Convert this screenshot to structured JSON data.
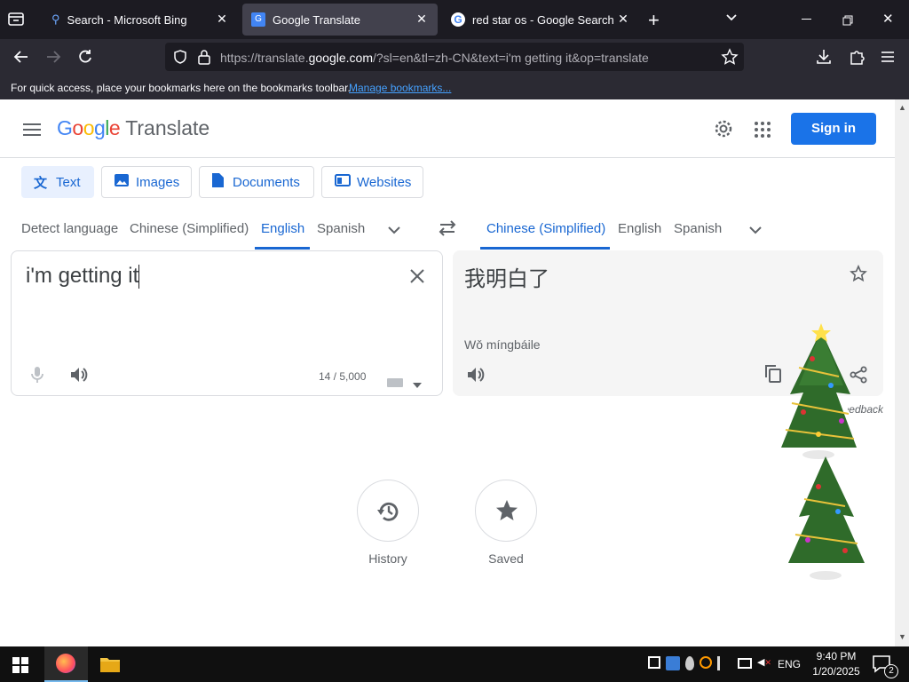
{
  "browser": {
    "tabs": [
      {
        "title": "Search - Microsoft Bing",
        "icon": "search-icon"
      },
      {
        "title": "Google Translate",
        "icon": "translate-icon"
      },
      {
        "title": "red star os - Google Search",
        "icon": "google-icon"
      }
    ],
    "url": {
      "prefix": "https://translate.",
      "domain": "google.com",
      "suffix": "/?sl=en&tl=zh-CN&text=i'm getting it&op=translate"
    },
    "bookmarks_text": "For quick access, place your bookmarks here on the bookmarks toolbar.",
    "bookmarks_link": "Manage bookmarks..."
  },
  "header": {
    "logo": "Google",
    "product": "Translate",
    "signin": "Sign in"
  },
  "modes": [
    "Text",
    "Images",
    "Documents",
    "Websites"
  ],
  "source_langs": [
    "Detect language",
    "Chinese (Simplified)",
    "English",
    "Spanish"
  ],
  "target_langs": [
    "Chinese (Simplified)",
    "English",
    "Spanish"
  ],
  "source": {
    "text": "i'm getting it",
    "count": "14 / 5,000"
  },
  "target": {
    "text": "我明白了",
    "romanization": "Wǒ míngbáile",
    "feedback": "Send feedback"
  },
  "actions": {
    "history": "History",
    "saved": "Saved"
  },
  "taskbar": {
    "language": "ENG",
    "time": "9:40 PM",
    "date": "1/20/2025",
    "notifications": "2"
  },
  "colors": {
    "accent": "#1a73e8",
    "link": "#1967d2",
    "browser_bg": "#1c1b22"
  }
}
